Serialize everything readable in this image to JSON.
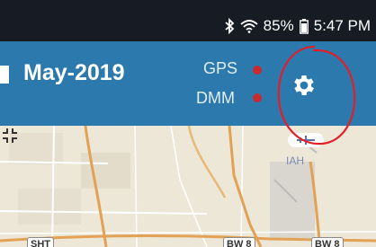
{
  "status_bar": {
    "battery_percent": "85%",
    "time": "5:47 PM",
    "icons": [
      "bluetooth-icon",
      "wifi-icon",
      "battery-icon"
    ]
  },
  "app_bar": {
    "month_label": "May-2019",
    "indicators": [
      {
        "label": "GPS",
        "status_color": "#c92a30"
      },
      {
        "label": "DMM",
        "status_color": "#c92a30"
      }
    ],
    "settings_icon": "gear-icon",
    "accent_color": "#2b79ad"
  },
  "map": {
    "airport_label": "IAH",
    "road_badges": [
      "BW 8",
      "BW 8"
    ],
    "partial_badge": "SHT"
  }
}
